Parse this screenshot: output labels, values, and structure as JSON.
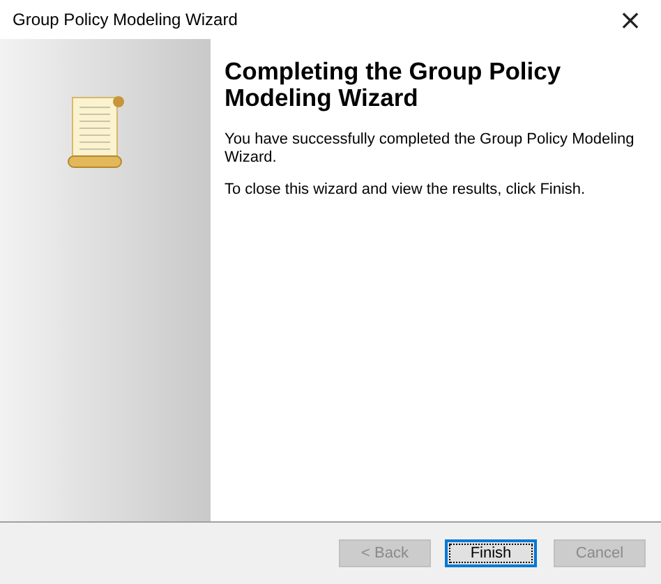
{
  "window": {
    "title": "Group Policy Modeling Wizard",
    "close": "×"
  },
  "heading": "Completing the Group Policy Modeling Wizard",
  "paragraphs": [
    "You have successfully completed the Group Policy Modeling Wizard.",
    "To close this wizard and view the results, click Finish."
  ],
  "buttons": [
    {
      "label": "< Back",
      "disabled": true,
      "focused": false
    },
    {
      "label": "Finish",
      "disabled": false,
      "focused": true
    },
    {
      "label": "Cancel",
      "disabled": true,
      "focused": false
    }
  ]
}
